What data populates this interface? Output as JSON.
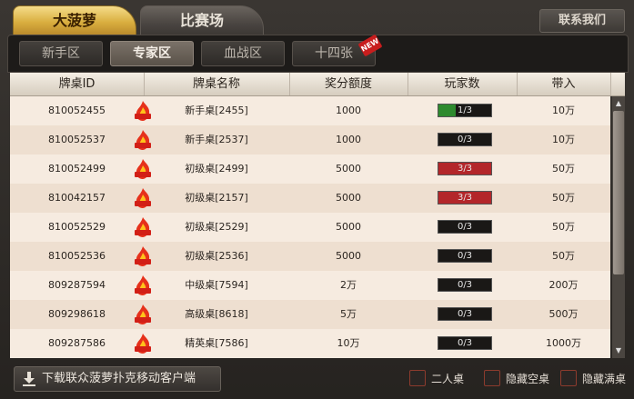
{
  "tabs": {
    "main_active": "大菠萝",
    "main_other": "比赛场",
    "contact": "联系我们"
  },
  "subtabs": [
    {
      "label": "新手区",
      "active": false
    },
    {
      "label": "专家区",
      "active": true
    },
    {
      "label": "血战区",
      "active": false
    },
    {
      "label": "十四张",
      "active": false,
      "badge": "NEW"
    }
  ],
  "table": {
    "headers": [
      "牌桌ID",
      "牌桌名称",
      "奖分额度",
      "玩家数",
      "带入"
    ],
    "rows": [
      {
        "id": "810052455",
        "name": "新手桌[2455]",
        "reward": "1000",
        "players": "1/3",
        "fill": 0.33,
        "fill_color": "#2e8a2e",
        "buyin": "10万"
      },
      {
        "id": "810052537",
        "name": "新手桌[2537]",
        "reward": "1000",
        "players": "0/3",
        "fill": 0,
        "fill_color": "#2e8a2e",
        "buyin": "10万"
      },
      {
        "id": "810052499",
        "name": "初级桌[2499]",
        "reward": "5000",
        "players": "3/3",
        "fill": 1,
        "fill_color": "#b3262a",
        "buyin": "50万"
      },
      {
        "id": "810042157",
        "name": "初级桌[2157]",
        "reward": "5000",
        "players": "3/3",
        "fill": 1,
        "fill_color": "#b3262a",
        "buyin": "50万"
      },
      {
        "id": "810052529",
        "name": "初级桌[2529]",
        "reward": "5000",
        "players": "0/3",
        "fill": 0,
        "fill_color": "#2e8a2e",
        "buyin": "50万"
      },
      {
        "id": "810052536",
        "name": "初级桌[2536]",
        "reward": "5000",
        "players": "0/3",
        "fill": 0,
        "fill_color": "#2e8a2e",
        "buyin": "50万"
      },
      {
        "id": "809287594",
        "name": "中级桌[7594]",
        "reward": "2万",
        "players": "0/3",
        "fill": 0,
        "fill_color": "#2e8a2e",
        "buyin": "200万"
      },
      {
        "id": "809298618",
        "name": "高级桌[8618]",
        "reward": "5万",
        "players": "0/3",
        "fill": 0,
        "fill_color": "#2e8a2e",
        "buyin": "500万"
      },
      {
        "id": "809287586",
        "name": "精英桌[7586]",
        "reward": "10万",
        "players": "0/3",
        "fill": 0,
        "fill_color": "#2e8a2e",
        "buyin": "1000万"
      }
    ]
  },
  "hot_icon": "flame-event-icon",
  "bottom": {
    "download": "下载联众菠萝扑克移动客户端",
    "checks": [
      "二人桌",
      "隐藏空桌",
      "隐藏满桌"
    ]
  }
}
